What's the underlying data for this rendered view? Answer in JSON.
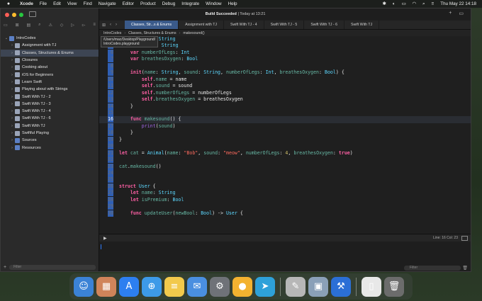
{
  "menubar": {
    "apple": "",
    "items": [
      "Xcode",
      "File",
      "Edit",
      "View",
      "Find",
      "Navigate",
      "Editor",
      "Product",
      "Debug",
      "Integrate",
      "Window",
      "Help"
    ],
    "datetime": "Thu May 22  14:18"
  },
  "window": {
    "build_status_bold": "Build Succeeded",
    "build_status_rest": " | Today at 13:21"
  },
  "sidebar": {
    "items": [
      {
        "label": "IntroCodes",
        "type": "folder",
        "chevron": "⌄"
      },
      {
        "label": "Assignment with TJ",
        "type": "pg",
        "chevron": "›"
      },
      {
        "label": "Classes, Structures & Enums",
        "type": "pg",
        "chevron": "›",
        "selected": true
      },
      {
        "label": "Closures",
        "type": "pg",
        "chevron": "›"
      },
      {
        "label": "Cooking about",
        "type": "pg",
        "chevron": "›"
      },
      {
        "label": "iOS for Beginners",
        "type": "pg",
        "chevron": "›"
      },
      {
        "label": "Learn Swift",
        "type": "pg",
        "chevron": "›"
      },
      {
        "label": "Playing about with Strings",
        "type": "pg",
        "chevron": "›"
      },
      {
        "label": "Swift With TJ - 2",
        "type": "pg",
        "chevron": "›"
      },
      {
        "label": "Swift With TJ - 3",
        "type": "pg",
        "chevron": "›"
      },
      {
        "label": "Swift With TJ - 4",
        "type": "pg",
        "chevron": "›"
      },
      {
        "label": "Swift With TJ - 6",
        "type": "pg",
        "chevron": "›"
      },
      {
        "label": "Swift With TJ",
        "type": "pg",
        "chevron": "›"
      },
      {
        "label": "Swiftful Playing",
        "type": "pg",
        "chevron": "›"
      },
      {
        "label": "Sources",
        "type": "folder",
        "chevron": "›"
      },
      {
        "label": "Resources",
        "type": "folder",
        "chevron": "›"
      }
    ],
    "filter_placeholder": "Filter"
  },
  "tabs": [
    {
      "label": "Classes, Str...s & Enums",
      "active": true
    },
    {
      "label": "Assignment with TJ",
      "active": false
    },
    {
      "label": "Swift With TJ - 4",
      "active": false
    },
    {
      "label": "Swift With TJ - 5",
      "active": false
    },
    {
      "label": "Swift With TJ - 6",
      "active": false
    },
    {
      "label": "Swift With TJ",
      "active": false
    }
  ],
  "jumpbar": {
    "project": "IntroCodes",
    "file": "Classes, Structures & Enums",
    "symbol": "makesound()"
  },
  "tooltip": {
    "line1": "/Users/mac/Desktop/Playground/",
    "line2": "IntroCodes.playground"
  },
  "code": [
    {
      "n": "4",
      "html": "    <span class='k'>let</span> <span class='p'>name</span>: <span class='t'>String</span>"
    },
    {
      "n": "5",
      "html": "    <span class='k'>var</span> <span class='p'>sound</span>: <span class='t'>String</span>"
    },
    {
      "n": "6",
      "html": "    <span class='k'>var</span> <span class='p'>numberOfLegs</span>: <span class='t'>Int</span>"
    },
    {
      "n": "7",
      "html": "    <span class='k'>var</span> <span class='p'>breathesOxygen</span>: <span class='t'>Bool</span>"
    },
    {
      "n": "8",
      "html": ""
    },
    {
      "n": "9",
      "html": "    <span class='k'>init</span>(<span class='p'>name</span>: <span class='t'>String</span>, <span class='p'>sound</span>: <span class='t'>String</span>, <span class='p'>numberOfLegs</span>: <span class='t'>Int</span>, <span class='p'>breathesOxygen</span>: <span class='t'>Bool</span>) {"
    },
    {
      "n": "10",
      "html": "        <span class='k'>self</span>.<span class='p'>name</span> = name"
    },
    {
      "n": "11",
      "html": "        <span class='k'>self</span>.<span class='p'>sound</span> = sound"
    },
    {
      "n": "12",
      "html": "        <span class='k'>self</span>.<span class='p'>numberOfLegs</span> = numberOfLegs"
    },
    {
      "n": "13",
      "html": "        <span class='k'>self</span>.<span class='p'>breathesOxygen</span> = breathesOxygen"
    },
    {
      "n": "14",
      "html": "    }"
    },
    {
      "n": "15",
      "html": ""
    },
    {
      "n": "16",
      "html": "    <span class='k'>func</span> <span class='p'>makesound</span>() {",
      "cur": true
    },
    {
      "n": "17",
      "html": "        <span class='f'>print</span>(<span class='p'>sound</span>)"
    },
    {
      "n": "18",
      "html": "    }"
    },
    {
      "n": "19",
      "html": "}"
    },
    {
      "n": "20",
      "html": ""
    },
    {
      "n": "21",
      "html": "<span class='k'>let</span> <span class='p'>cat</span> = <span class='t'>Animal</span>(<span class='p'>name</span>: <span class='s'>\"Bob\"</span>, <span class='p'>sound</span>: <span class='s'>\"meow\"</span>, <span class='p'>numberOfLegs</span>: <span class='n'>4</span>, <span class='p'>breathesOxygen</span>: <span class='k'>true</span>)"
    },
    {
      "n": "22",
      "html": ""
    },
    {
      "n": "23",
      "html": "<span class='p'>cat</span>.<span class='p'>makesound</span>()"
    },
    {
      "n": "24",
      "html": ""
    },
    {
      "n": "25",
      "html": ""
    },
    {
      "n": "26",
      "html": "<span class='k'>struct</span> <span class='t'>User</span> {"
    },
    {
      "n": "27",
      "html": "    <span class='k'>let</span> <span class='p'>name</span>: <span class='t'>String</span>"
    },
    {
      "n": "28",
      "html": "    <span class='k'>let</span> <span class='p'>isPremium</span>: <span class='t'>Bool</span>"
    },
    {
      "n": "29",
      "html": ""
    },
    {
      "n": "30",
      "html": "    <span class='k'>func</span> <span class='p'>updateUser</span>(<span class='p'>newBool</span>: <span class='t'>Bool</span>) -> <span class='t'>User</span> {"
    }
  ],
  "debug": {
    "position": "Line: 16  Col: 23"
  },
  "console_filter_placeholder": "Filter",
  "dock": [
    {
      "name": "finder-icon",
      "glyph": "☺",
      "color": "#3b82d6"
    },
    {
      "name": "launchpad-icon",
      "glyph": "▦",
      "color": "#d0845a"
    },
    {
      "name": "app-store-icon",
      "glyph": "A",
      "color": "#2d7ff0"
    },
    {
      "name": "safari-icon",
      "glyph": "⊕",
      "color": "#3d9ae8"
    },
    {
      "name": "notes-icon",
      "glyph": "≡",
      "color": "#f2c94c"
    },
    {
      "name": "mail-icon",
      "glyph": "✉",
      "color": "#4a8fe0"
    },
    {
      "name": "system-settings-icon",
      "glyph": "⚙",
      "color": "#6f7278"
    },
    {
      "name": "tips-icon",
      "glyph": "●",
      "color": "#f3b230"
    },
    {
      "name": "telegram-icon",
      "glyph": "➤",
      "color": "#2ea1d9"
    },
    {
      "name": "playgrounds-icon",
      "glyph": "✎",
      "color": "#b7b7b7"
    },
    {
      "name": "preview-icon",
      "glyph": "▣",
      "color": "#8aa0b8"
    },
    {
      "name": "xcode-icon",
      "glyph": "⚒",
      "color": "#2b6fd6"
    },
    {
      "name": "document-icon",
      "glyph": "▯",
      "color": "#e8e8e8"
    },
    {
      "name": "trash-icon",
      "glyph": "🗑",
      "color": "#6c6c6c"
    }
  ]
}
